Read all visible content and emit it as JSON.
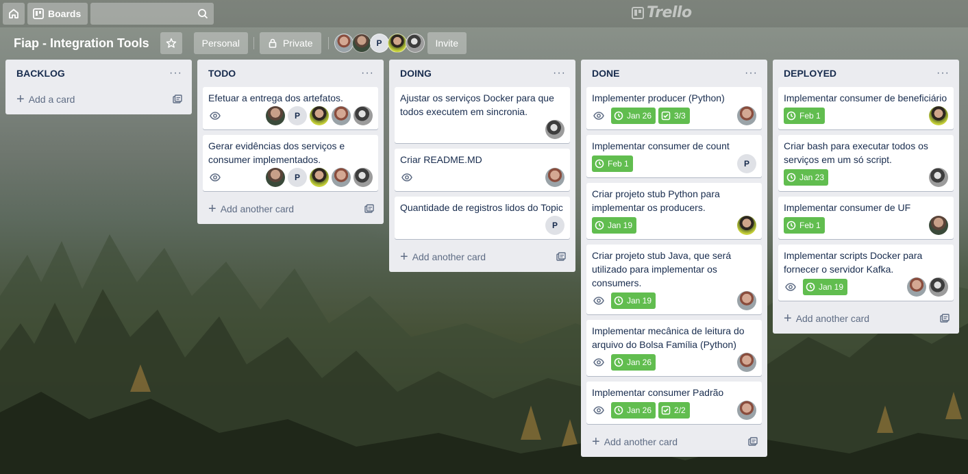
{
  "header": {
    "home_icon": "home-icon",
    "boards_label": "Boards",
    "search_value": "",
    "logo_text": "Trello"
  },
  "board": {
    "title": "Fiap - Integration Tools",
    "visibility_team": "Personal",
    "visibility_private": "Private",
    "invite_label": "Invite",
    "member_initial": "P"
  },
  "lists": [
    {
      "title": "BACKLOG",
      "add_label": "Add a card",
      "cards": []
    },
    {
      "title": "TODO",
      "add_label": "Add another card",
      "cards": [
        {
          "title": "Efetuar a entrega dos artefatos.",
          "watching": true,
          "members": [
            "a",
            "P",
            "b",
            "c",
            "d"
          ]
        },
        {
          "title": "Gerar evidências dos serviços e consumer implementados.",
          "watching": true,
          "members": [
            "a",
            "P",
            "b",
            "c",
            "d"
          ]
        }
      ]
    },
    {
      "title": "DOING",
      "add_label": "Add another card",
      "cards": [
        {
          "title": "Ajustar os serviços Docker para que todos executem em sincronia.",
          "members": [
            "d"
          ]
        },
        {
          "title": "Criar README.MD",
          "watching": true,
          "members": [
            "c"
          ]
        },
        {
          "title": "Quantidade de registros lidos do Topic",
          "members": [
            "P"
          ]
        }
      ]
    },
    {
      "title": "DONE",
      "add_label": "Add another card",
      "cards": [
        {
          "title": "Implementer producer (Python)",
          "watching": true,
          "due": "Jan 26",
          "checklist": "3/3",
          "members": [
            "c"
          ]
        },
        {
          "title": "Implementar consumer de count",
          "due": "Feb 1",
          "members": [
            "P"
          ]
        },
        {
          "title": "Criar projeto stub Python para implementar os producers.",
          "due": "Jan 19",
          "members": [
            "b"
          ]
        },
        {
          "title": "Criar projeto stub Java, que será utilizado para implementar os consumers.",
          "watching": true,
          "due": "Jan 19",
          "members": [
            "c"
          ]
        },
        {
          "title": "Implementar mecânica de leitura do arquivo do Bolsa Família (Python)",
          "watching": true,
          "due": "Jan 26",
          "members": [
            "c"
          ]
        },
        {
          "title": "Implementar consumer Padrão",
          "watching": true,
          "due": "Jan 26",
          "checklist": "2/2",
          "members": [
            "c"
          ]
        }
      ]
    },
    {
      "title": "DEPLOYED",
      "add_label": "Add another card",
      "cards": [
        {
          "title": "Implementar consumer de beneficiário",
          "due": "Feb 1",
          "members": [
            "b"
          ]
        },
        {
          "title": "Criar bash para executar todos os serviços em um só script.",
          "due": "Jan 23",
          "members": [
            "d"
          ]
        },
        {
          "title": "Implementar consumer de UF",
          "due": "Feb 1",
          "members": [
            "a"
          ]
        },
        {
          "title": "Implementar scripts Docker para fornecer o servidor Kafka.",
          "watching": true,
          "due": "Jan 19",
          "members": [
            "c",
            "d"
          ]
        }
      ]
    }
  ],
  "colors": {
    "due_complete": "#61bd4f",
    "list_bg": "#ebecf0"
  }
}
